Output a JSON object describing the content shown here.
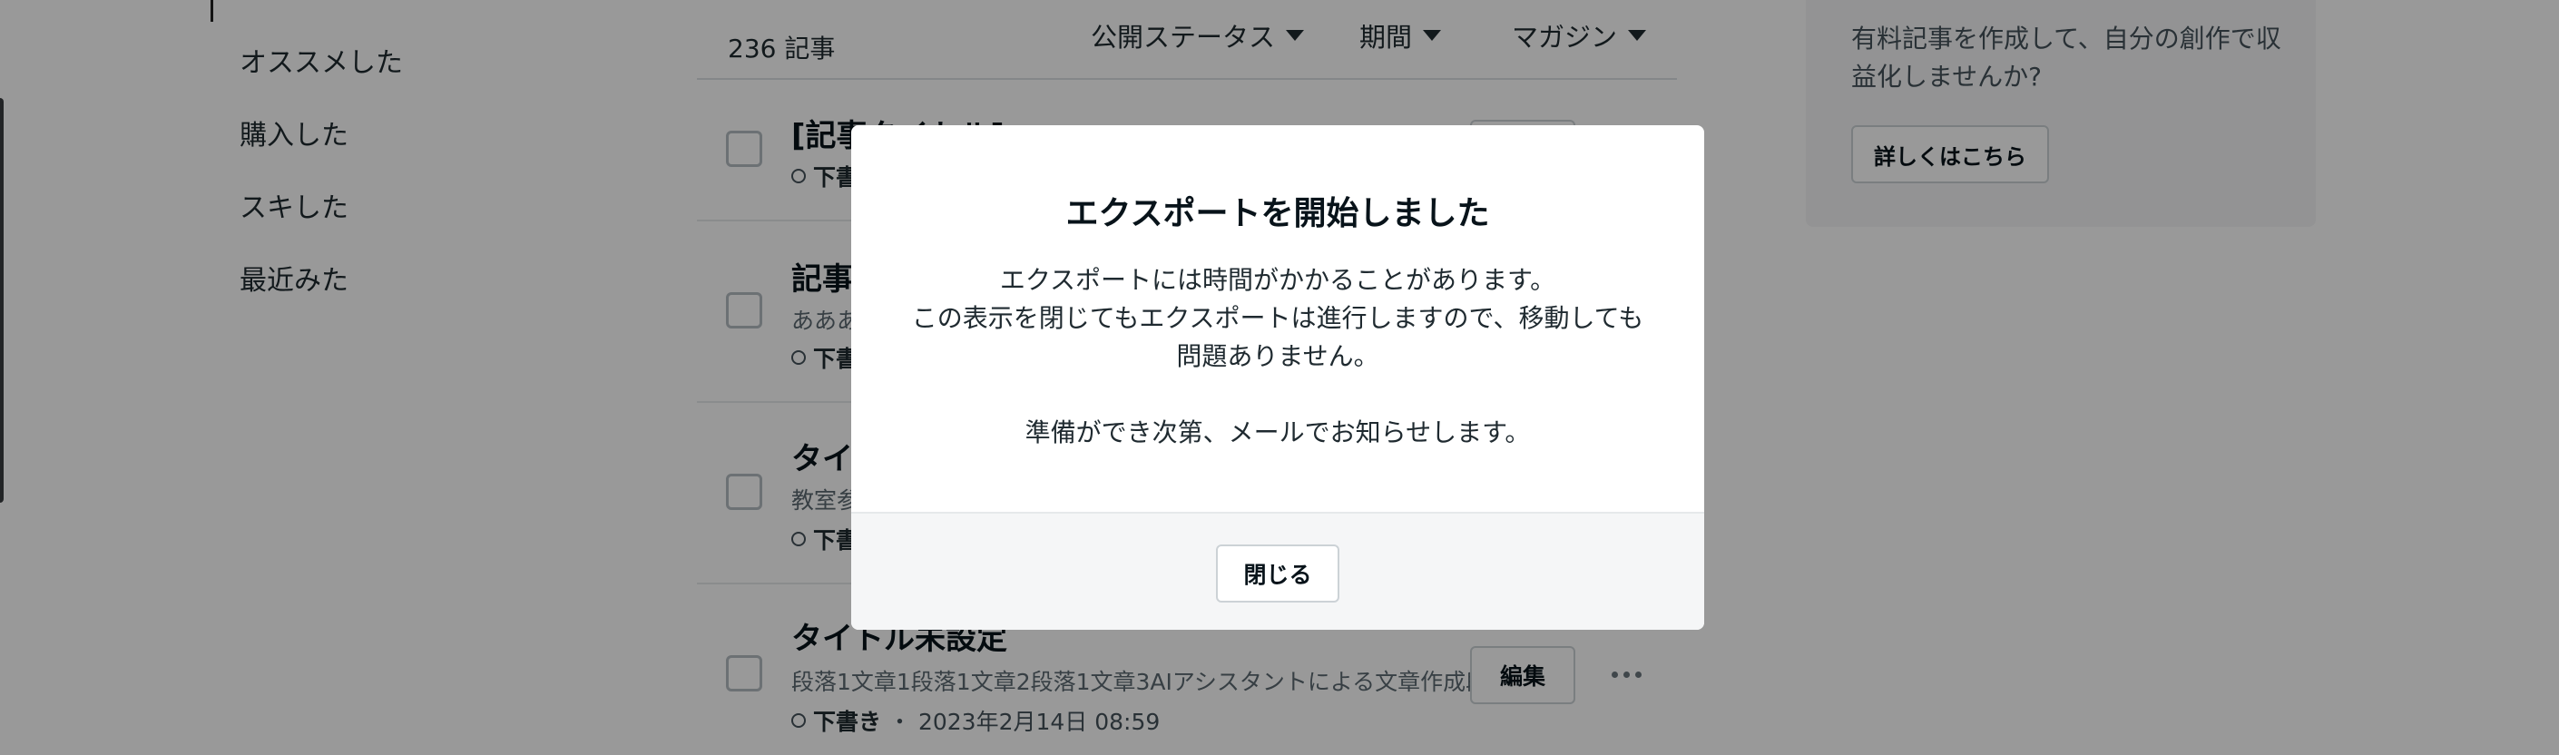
{
  "sidebar": {
    "items": [
      {
        "label": "オススメした"
      },
      {
        "label": "購入した"
      },
      {
        "label": "スキした"
      },
      {
        "label": "最近みた"
      }
    ]
  },
  "list_header": {
    "count": "236 記事",
    "filters": [
      {
        "label": "公開ステータス"
      },
      {
        "label": "期間"
      },
      {
        "label": "マガジン"
      }
    ]
  },
  "articles": [
    {
      "title": "[記事タイトル]",
      "description": "",
      "status": "下書"
    },
    {
      "title": "記事",
      "description": "あああ",
      "status": "下書"
    },
    {
      "title": "タイ",
      "description": "教室参",
      "status": "下書"
    },
    {
      "title": "タイトル未設定",
      "description": "段落1文章1段落1文章2段落1文章3AIアシスタントによる文章作成段…",
      "status": "下書き",
      "date": "・ 2023年2月14日 08:59",
      "edit_label": "編集"
    }
  ],
  "promo": {
    "text": "有料記事を作成して、自分の創作で収益化しませんか?",
    "button_label": "詳しくはこちら"
  },
  "modal": {
    "title": "エクスポートを開始しました",
    "line1": "エクスポートには時間がかかることがあります。",
    "line2": "この表示を閉じてもエクスポートは進行しますので、移動しても問題ありません。",
    "line3": "準備ができ次第、メールでお知らせします。",
    "close_label": "閉じる"
  }
}
